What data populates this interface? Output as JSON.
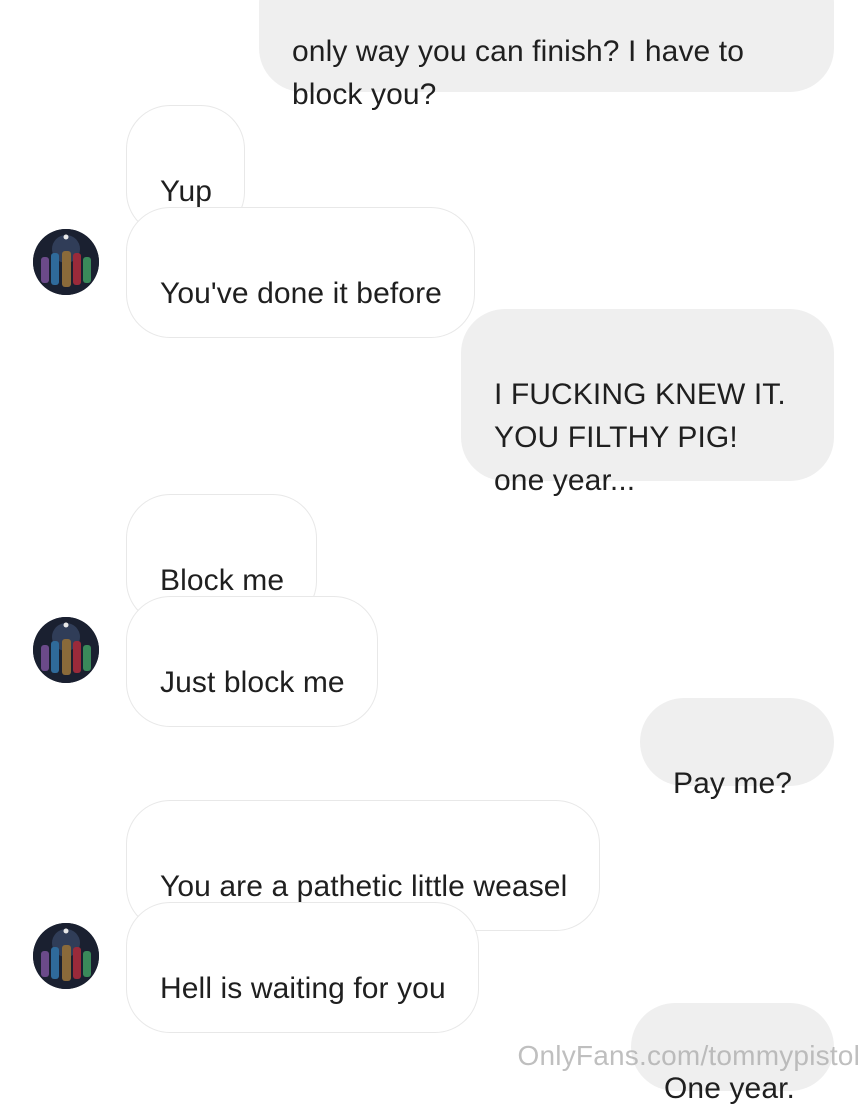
{
  "messages": [
    {
      "side": "out",
      "text": "only way you can finish? I have to\nblock you?"
    },
    {
      "side": "in",
      "text": "Yup"
    },
    {
      "side": "in",
      "text": "You've done it before"
    },
    {
      "side": "out",
      "text": "I FUCKING KNEW IT.\nYOU FILTHY PIG!\none year..."
    },
    {
      "side": "in",
      "text": "Block me"
    },
    {
      "side": "in",
      "text": "Just block me"
    },
    {
      "side": "out",
      "text": "Pay me?"
    },
    {
      "side": "in",
      "text": "You are a pathetic little weasel"
    },
    {
      "side": "in",
      "text": "Hell is waiting for you"
    },
    {
      "side": "out",
      "text": "One year."
    }
  ],
  "watermark": "OnlyFans.com/tommypistol"
}
